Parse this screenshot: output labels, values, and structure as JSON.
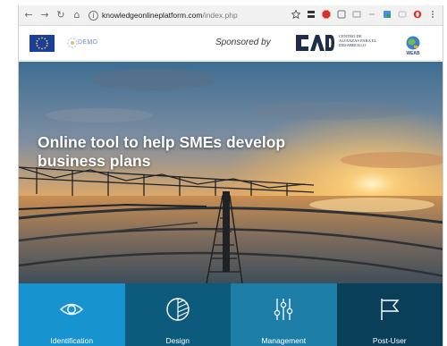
{
  "browser": {
    "url_host": "knowledgeonlineplatform.com",
    "url_path": "/index.php"
  },
  "header": {
    "demo_logo_text": "DEMO",
    "sponsored_label": "Sponsored by",
    "cad_logo_text": "CENTRO DE ALIANZAS PARA EL DESARROLLO",
    "weab_logo_text": "WEAB"
  },
  "hero": {
    "title": "Online tool to help SMEs develop business plans"
  },
  "tiles": [
    {
      "label": "Identification",
      "icon": "eye-icon",
      "color": "#1794d0"
    },
    {
      "label": "Design",
      "icon": "design-circle-icon",
      "color": "#0d5b7c"
    },
    {
      "label": "Management",
      "icon": "sliders-icon",
      "color": "#1d7fa8"
    },
    {
      "label": "Post-User",
      "icon": "flag-icon",
      "color": "#0a3f5a"
    }
  ]
}
